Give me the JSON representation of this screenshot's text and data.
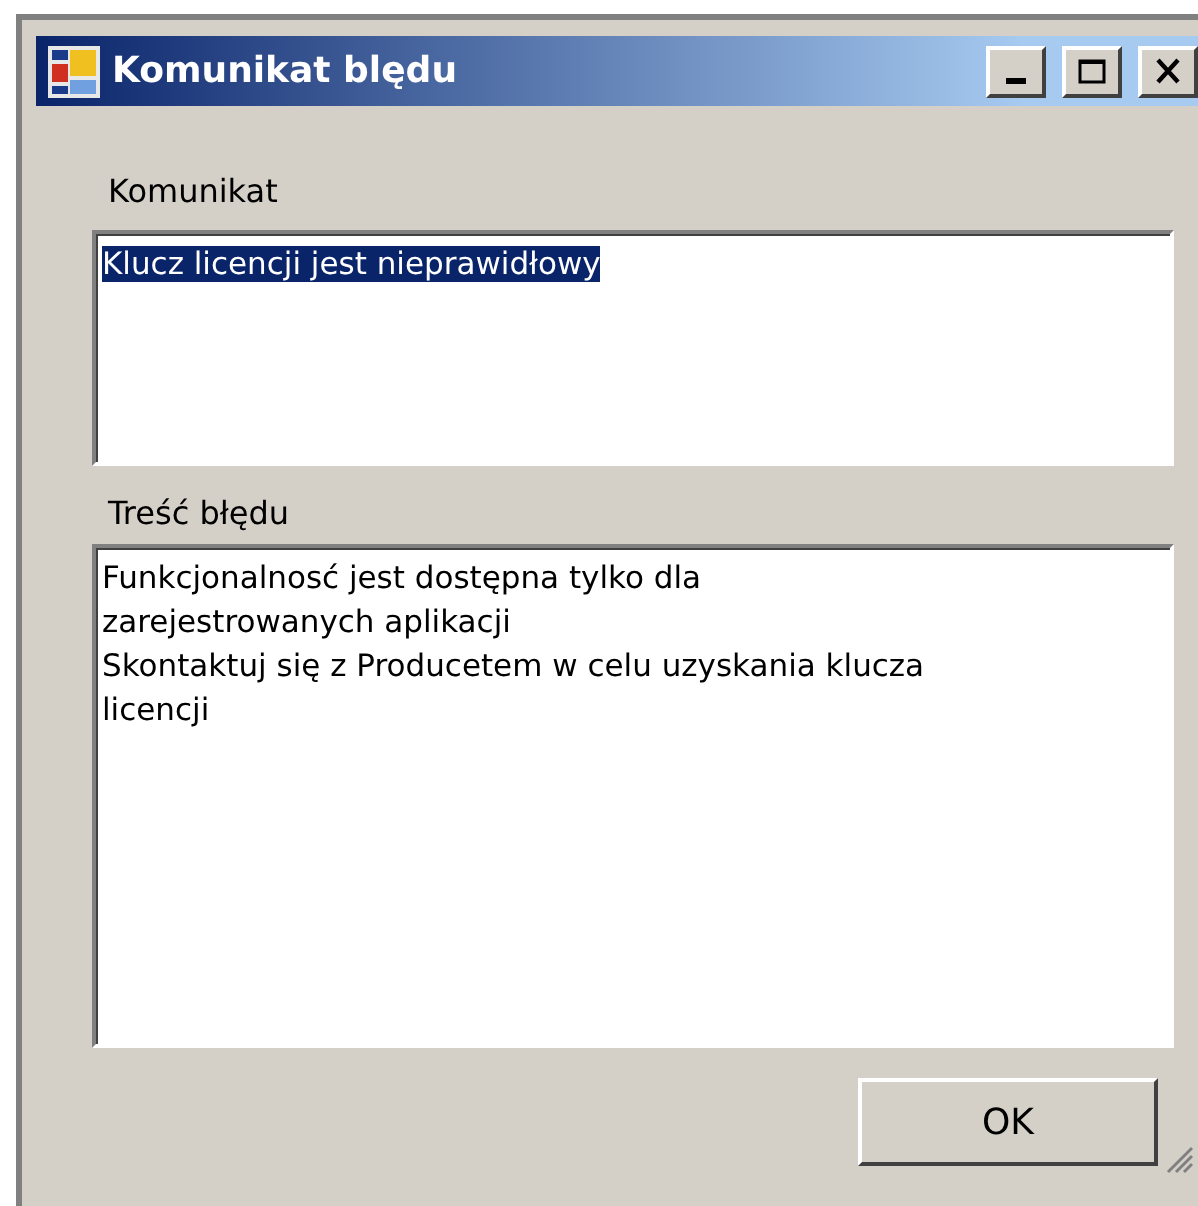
{
  "window": {
    "title": "Komunikat blędu"
  },
  "message": {
    "label": "Komunikat",
    "value": "Klucz licencji jest nieprawidłowy",
    "selected": true
  },
  "details": {
    "label": "Treść błędu",
    "lines": [
      "Funkcjonalnosć jest dostępna tylko dla",
      "zarejestrowanych aplikacji",
      "Skontaktuj się z Producetem w celu uzyskania klucza",
      "licencji"
    ]
  },
  "buttons": [
    "OK"
  ]
}
